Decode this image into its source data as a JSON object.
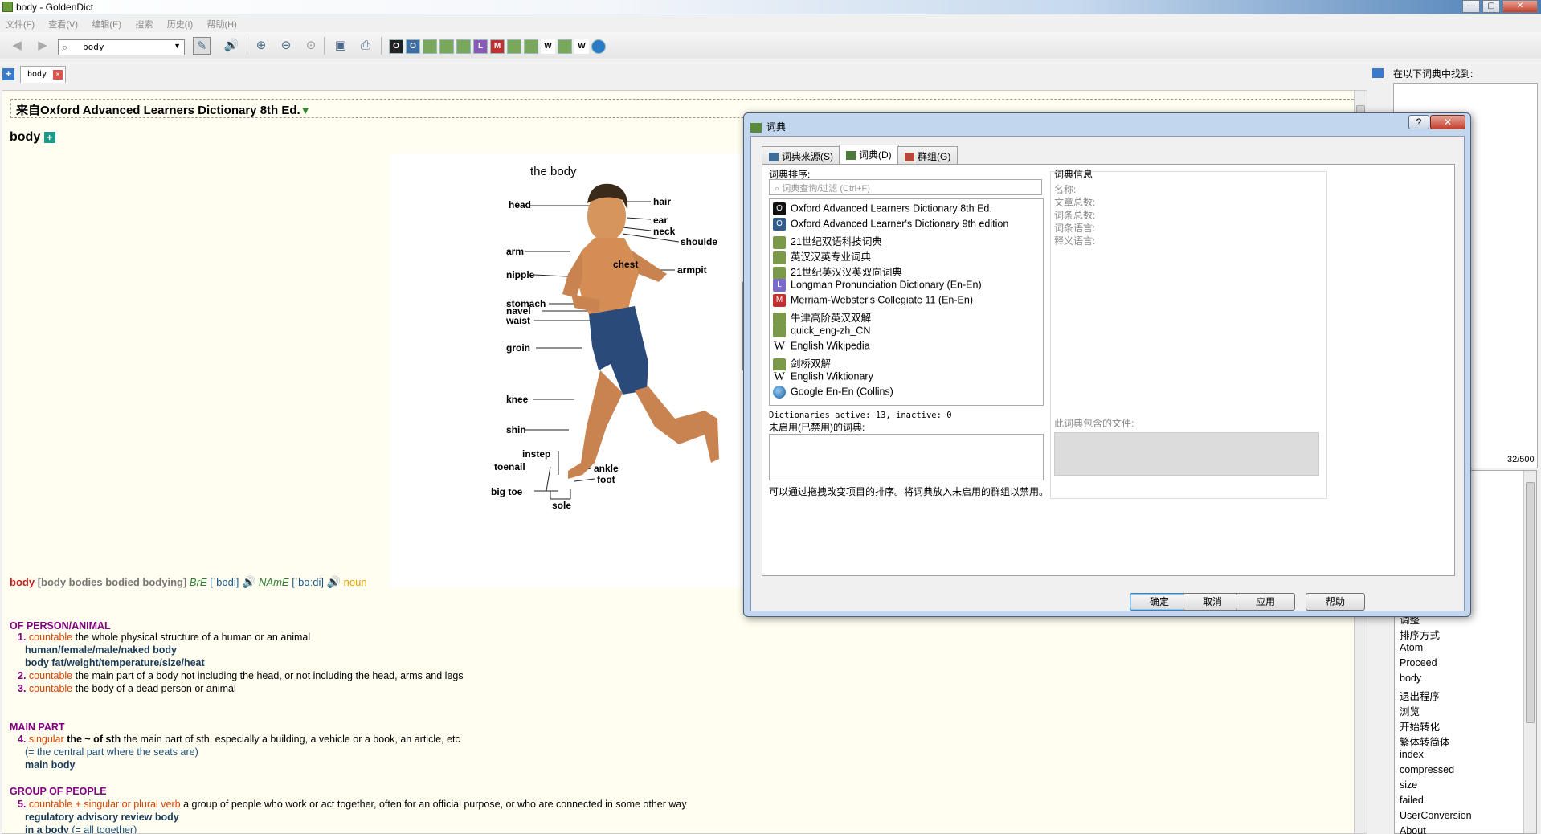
{
  "window": {
    "title": "body - GoldenDict",
    "minimize": "—",
    "maximize": "▢",
    "close": "✕"
  },
  "menu": [
    "文件(F)",
    "查看(V)",
    "编辑(E)",
    "搜索",
    "历史(I)",
    "帮助(H)"
  ],
  "toolbar": {
    "search_value": "body",
    "icons": [
      "back-icon",
      "forward-icon",
      "scan-pen-icon",
      "speaker-icon",
      "zoom-in-icon",
      "zoom-out-icon",
      "zoom-reset-icon",
      "save-icon",
      "print-icon"
    ],
    "dict_icons": [
      "O",
      "O",
      "",
      "",
      "",
      "",
      "L",
      "M",
      "",
      "",
      "W",
      "",
      "W",
      ""
    ]
  },
  "tab": {
    "label": "body",
    "close": "✕",
    "new": "+"
  },
  "article": {
    "dict_header": "来自Oxford Advanced Learners Dictionary 8th Ed.",
    "dict_header_arrow": "▼",
    "headword": "body",
    "headword_plus": "+",
    "picture": {
      "title": "the body",
      "labels": {
        "head": "head",
        "hair": "hair",
        "ear": "ear",
        "neck": "neck",
        "shoulder": "shoulde",
        "arm": "arm",
        "chest": "chest",
        "armpit": "armpit",
        "nipple": "nipple",
        "stomach": "stomach",
        "navel": "navel",
        "waist": "waist",
        "groin": "groin",
        "knee": "knee",
        "shin": "shin",
        "instep": "instep",
        "toenail": "toenail",
        "ankle": "ankle",
        "foot": "foot",
        "big_toe": "big toe",
        "sole": "sole"
      }
    },
    "entry": {
      "word": "body",
      "forms": "[body bodies bodied bodying]",
      "bre": "BrE",
      "bre_ipa": "[ˈbɒdi]",
      "name": "NAmE",
      "name_ipa": "[ˈbɑːdi]",
      "pos": "noun"
    },
    "sections": [
      {
        "title": "OF PERSON/ANIMAL",
        "defs": [
          {
            "num": "1.",
            "cat": "countable",
            "text": "the whole physical structure of a human or an animal"
          },
          {
            "num": "2.",
            "cat": "countable",
            "text": "the main part of a body not including the head, or not including the head, arms and legs"
          },
          {
            "num": "3.",
            "cat": "countable",
            "text": "the body of a dead person or animal"
          }
        ],
        "examples": [
          "human/female/male/naked body",
          "body fat/weight/temperature/size/heat"
        ]
      },
      {
        "title": "MAIN PART",
        "defs": [
          {
            "num": "4.",
            "cat": "singular",
            "pattern": "the ~ of sth",
            "text": "the main part of sth, especially a building, a vehicle or a book, an article, etc"
          }
        ],
        "notes": [
          "(= the central part where the seats are)"
        ],
        "examples": [
          "main body"
        ]
      },
      {
        "title": "GROUP OF PEOPLE",
        "defs": [
          {
            "num": "5.",
            "cat": "countable + singular or plural verb",
            "text": "a group of people who work or act together, often for an official purpose, or who are connected in some other way"
          }
        ],
        "examples": [
          "regulatory advisory review body",
          "in a body"
        ],
        "notes": [
          "(= all together)"
        ]
      }
    ]
  },
  "right_panel": {
    "found_in": "在以下词典中找到:",
    "count": "32/500",
    "history": [
      "调整",
      "排序方式",
      "Atom",
      "Proceed",
      "body",
      "退出程序",
      "浏览",
      "开始转化",
      "繁体转简体",
      "index",
      "compressed",
      "size",
      "failed",
      "UserConversion",
      "About"
    ]
  },
  "dialog": {
    "title": "词典",
    "help": "?",
    "close": "✕",
    "tabs": [
      "词典来源(S)",
      "词典(D)",
      "群组(G)"
    ],
    "order_label": "词典排序:",
    "filter_placeholder": "词典查询/过滤 (Ctrl+F)",
    "dictionaries": [
      {
        "name": "Oxford Advanced Learners Dictionary 8th Ed.",
        "icon": "O"
      },
      {
        "name": "Oxford Advanced Learner's Dictionary 9th edition",
        "icon": "O"
      },
      {
        "name": "21世纪双语科技词典",
        "icon": ""
      },
      {
        "name": "英汉汉英专业词典",
        "icon": ""
      },
      {
        "name": "21世纪英汉汉英双向词典",
        "icon": ""
      },
      {
        "name": "Longman Pronunciation Dictionary (En-En)",
        "icon": "L"
      },
      {
        "name": "Merriam-Webster's Collegiate 11 (En-En)",
        "icon": "M"
      },
      {
        "name": "牛津高阶英汉双解",
        "icon": ""
      },
      {
        "name": "quick_eng-zh_CN",
        "icon": ""
      },
      {
        "name": "English Wikipedia",
        "icon": "W"
      },
      {
        "name": "剑桥双解",
        "icon": ""
      },
      {
        "name": "English Wiktionary",
        "icon": "W"
      },
      {
        "name": "Google En-En (Collins)",
        "icon": "G"
      }
    ],
    "active_status": "Dictionaries active: 13, inactive: 0",
    "disabled_label": "未启用(已禁用)的词典:",
    "hint": "可以通过拖拽改变项目的排序。将词典放入未启用的群组以禁用。",
    "info_title": "词典信息",
    "info_fields": [
      "名称:",
      "文章总数:",
      "词条总数:",
      "词条语言:",
      "释义语言:"
    ],
    "files_label": "此词典包含的文件:",
    "buttons": [
      "确定",
      "取消",
      "应用",
      "帮助"
    ]
  }
}
